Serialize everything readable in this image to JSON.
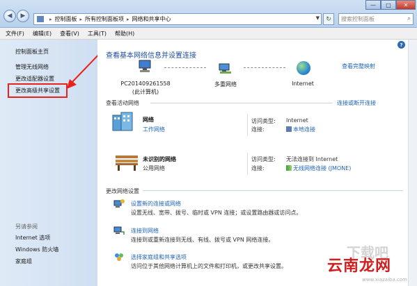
{
  "address": {
    "crumbs": [
      "控制面板",
      "所有控制面板项",
      "网络和共享中心"
    ],
    "search_placeholder": "搜索控制面板"
  },
  "menu": [
    "文件(F)",
    "编辑(E)",
    "查看(V)",
    "工具(T)",
    "帮助(H)"
  ],
  "sidebar": {
    "home": "控制面板主页",
    "wifi": "管理无线网络",
    "adapter": "更改适配器设置",
    "advanced": "更改高级共享设置",
    "see_also": "另请参阅",
    "ie": "Internet 选项",
    "firewall": "Windows 防火墙",
    "homegroup": "家庭组"
  },
  "main": {
    "title": "查看基本网络信息并设置连接",
    "full_map": "查看完整映射",
    "nodes": {
      "pc": "PC201409261558",
      "pc_sub": "(此计算机)",
      "multi": "多重网络",
      "internet": "Internet"
    },
    "active_header": "查看活动网络",
    "connect_link": "连接或断开连接",
    "networks": [
      {
        "name": "网络",
        "type": "工作网络",
        "access_label": "访问类型:",
        "access": "Internet",
        "conn_label": "连接:",
        "conn": "本地连接"
      },
      {
        "name": "未识别的网络",
        "type": "公用网络",
        "access_label": "访问类型:",
        "access": "无法连接到 Internet",
        "conn_label": "连接:",
        "conn": "无线网络连接 (JMONE)"
      }
    ],
    "change_header": "更改网络设置",
    "tasks": [
      {
        "link": "设置新的连接或网络",
        "desc": "设置无线、宽带、拨号、临时或 VPN 连接；或设置路由器或访问点。"
      },
      {
        "link": "连接到网络",
        "desc": "连接到或重新连接到无线、有线、拨号或 VPN 网络连接。"
      },
      {
        "link": "选择家庭组和共享选项",
        "desc": "访问位于其他网络计算机上的文件和打印机，或更改共享设置。"
      }
    ]
  },
  "watermark": {
    "text": "云南龙网",
    "grey": "下载吧",
    "url": "www.xiazaiba.com"
  }
}
